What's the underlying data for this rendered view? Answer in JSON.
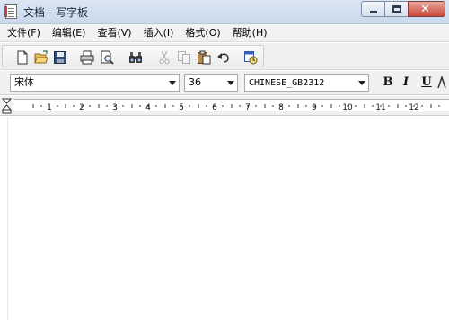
{
  "window": {
    "title": "文档 - 写字板",
    "controls": {
      "minimize": "minimize",
      "maximize": "maximize",
      "close": "close"
    }
  },
  "menu": {
    "items": [
      {
        "label": "文件(F)"
      },
      {
        "label": "编辑(E)"
      },
      {
        "label": "查看(V)"
      },
      {
        "label": "插入(I)"
      },
      {
        "label": "格式(O)"
      },
      {
        "label": "帮助(H)"
      }
    ]
  },
  "toolbar": {
    "icons": [
      {
        "name": "new-icon"
      },
      {
        "name": "open-icon"
      },
      {
        "name": "save-icon"
      },
      {
        "name": "print-icon"
      },
      {
        "name": "print-preview-icon"
      },
      {
        "name": "find-icon"
      },
      {
        "name": "cut-icon",
        "disabled": true
      },
      {
        "name": "copy-icon",
        "disabled": true
      },
      {
        "name": "paste-icon"
      },
      {
        "name": "undo-icon"
      },
      {
        "name": "insert-datetime-icon"
      }
    ]
  },
  "format": {
    "font_name": "宋体",
    "font_size": "36",
    "script": "CHINESE_GB2312",
    "bold_glyph": "B",
    "italic_glyph": "I",
    "underline_glyph": "U"
  },
  "ruler": {
    "labels": [
      "1",
      "2",
      "3",
      "4",
      "5",
      "6",
      "7",
      "8",
      "9",
      "10",
      "11",
      "12"
    ]
  },
  "document": {
    "content": ""
  }
}
